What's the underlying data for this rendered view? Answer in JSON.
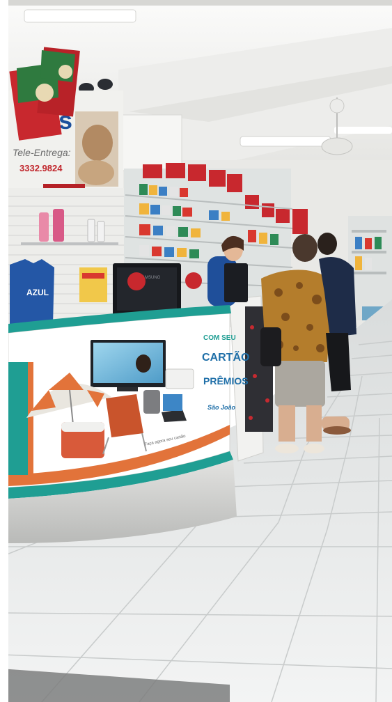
{
  "store_sign": {
    "brand_fragment": "as",
    "delivery_label": "Tele-Entrega:",
    "phone": "3332.9824"
  },
  "counter_ad": {
    "headline_lines": [
      "COM SEU",
      "CARTÃO",
      "PRÊMIOS"
    ],
    "brand": "São João",
    "tagline": "Faça agora seu cartão"
  },
  "tshirt_text": "AZUL",
  "monitor_brand": "SAMSUNG",
  "colors": {
    "counter_teal": "#1f9e93",
    "counter_orange": "#e2733a",
    "product_red": "#c8282e",
    "floor_tile": "#eceded",
    "ceiling": "#f4f4f2",
    "wall": "#e9e9e6",
    "staff_uniform": "#1f4f9a"
  }
}
